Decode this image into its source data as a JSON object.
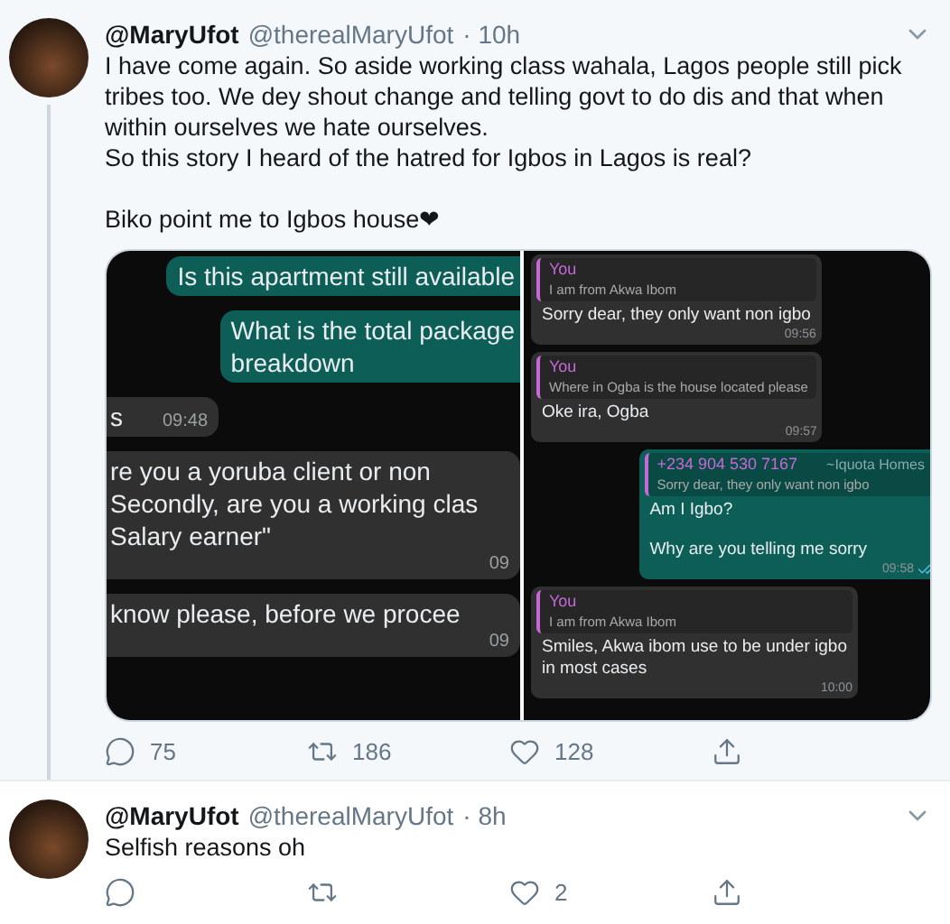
{
  "tweets": [
    {
      "name": "@MaryUfot",
      "handle": "@therealMaryUfot",
      "time": "· 10h",
      "thread": true,
      "highlighted": true,
      "text": [
        [
          "I have come again. So aside working class wahala, Lagos people still pick tribes too. We dey shout change and telling govt to do dis and that when within ourselves we hate ourselves.",
          "So this story I heard of the hatred for Igbos in Lagos is real?"
        ],
        [
          "Biko point me to Igbos house❤"
        ]
      ],
      "media": {
        "left": [
          {
            "kind": "out",
            "lines": [
              "Is this apartment still available"
            ]
          },
          {
            "kind": "out",
            "lines": [
              "What is the total package",
              "breakdown"
            ]
          },
          {
            "kind": "in",
            "lines": [
              "s"
            ],
            "time": "09:48",
            "inline_time": true
          },
          {
            "kind": "in",
            "lines": [
              "re you a yoruba client or non",
              "Secondly, are you a working clas",
              "Salary earner\""
            ],
            "time": "09",
            "inline_time": false
          },
          {
            "kind": "in",
            "lines": [
              "know please, before we procee"
            ],
            "time": "09",
            "inline_time": false
          }
        ],
        "right": [
          {
            "kind": "in",
            "quote": {
              "author": "You",
              "text": "I am from Akwa Ibom"
            },
            "blocks": [
              [
                "Sorry dear, they only want non igbo"
              ]
            ],
            "time": "09:56",
            "read": false
          },
          {
            "kind": "in",
            "quote": {
              "author": "You",
              "text": "Where in Ogba is the house located please"
            },
            "blocks": [
              [
                "Oke ira, Ogba"
              ]
            ],
            "time": "09:57",
            "read": false
          },
          {
            "kind": "out",
            "quote": {
              "author": "+234 904 530 7167",
              "alias": "~Iquota Homes",
              "text": "Sorry dear, they only want non igbo"
            },
            "blocks": [
              [
                "Am I Igbo?"
              ],
              [
                "Why are you telling me sorry"
              ]
            ],
            "time": "09:58",
            "read": true
          },
          {
            "kind": "in",
            "quote": {
              "author": "You",
              "text": "I am from Akwa Ibom"
            },
            "blocks": [
              [
                "Smiles, Akwa ibom use to be under igbo",
                "in most cases"
              ]
            ],
            "time": "10:00",
            "read": false
          }
        ]
      },
      "actions": [
        {
          "kind": "reply",
          "count": "75"
        },
        {
          "kind": "retweet",
          "count": "186"
        },
        {
          "kind": "like",
          "count": "128"
        },
        {
          "kind": "share"
        }
      ]
    },
    {
      "name": "@MaryUfot",
      "handle": "@therealMaryUfot",
      "time": "· 8h",
      "thread": false,
      "highlighted": false,
      "text": [
        [
          "Selfish reasons oh"
        ]
      ],
      "actions": [
        {
          "kind": "reply"
        },
        {
          "kind": "retweet"
        },
        {
          "kind": "like",
          "count": "2"
        },
        {
          "kind": "share"
        }
      ]
    }
  ]
}
